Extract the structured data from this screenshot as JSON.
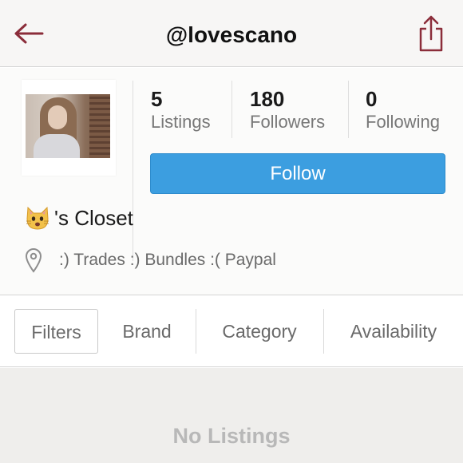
{
  "header": {
    "title": "@lovescano",
    "back_icon": "arrow-left-icon",
    "share_icon": "share-icon"
  },
  "profile": {
    "stats": [
      {
        "value": "5",
        "label": "Listings"
      },
      {
        "value": "180",
        "label": "Followers"
      },
      {
        "value": "0",
        "label": "Following"
      }
    ],
    "follow_label": "Follow",
    "closet_suffix": "'s Closet",
    "closet_icon": "cat-face-emoji-icon",
    "location_icon": "map-pin-icon",
    "bio": ":) Trades :) Bundles :( Paypal"
  },
  "filters": {
    "items": [
      "Filters",
      "Brand",
      "Category",
      "Availability"
    ]
  },
  "listings": {
    "empty_text": "No Listings"
  },
  "colors": {
    "accent_red": "#8b2d3a",
    "follow_blue": "#3c9ee0",
    "header_bg": "#f7f6f5",
    "empty_bg": "#efeeec"
  }
}
